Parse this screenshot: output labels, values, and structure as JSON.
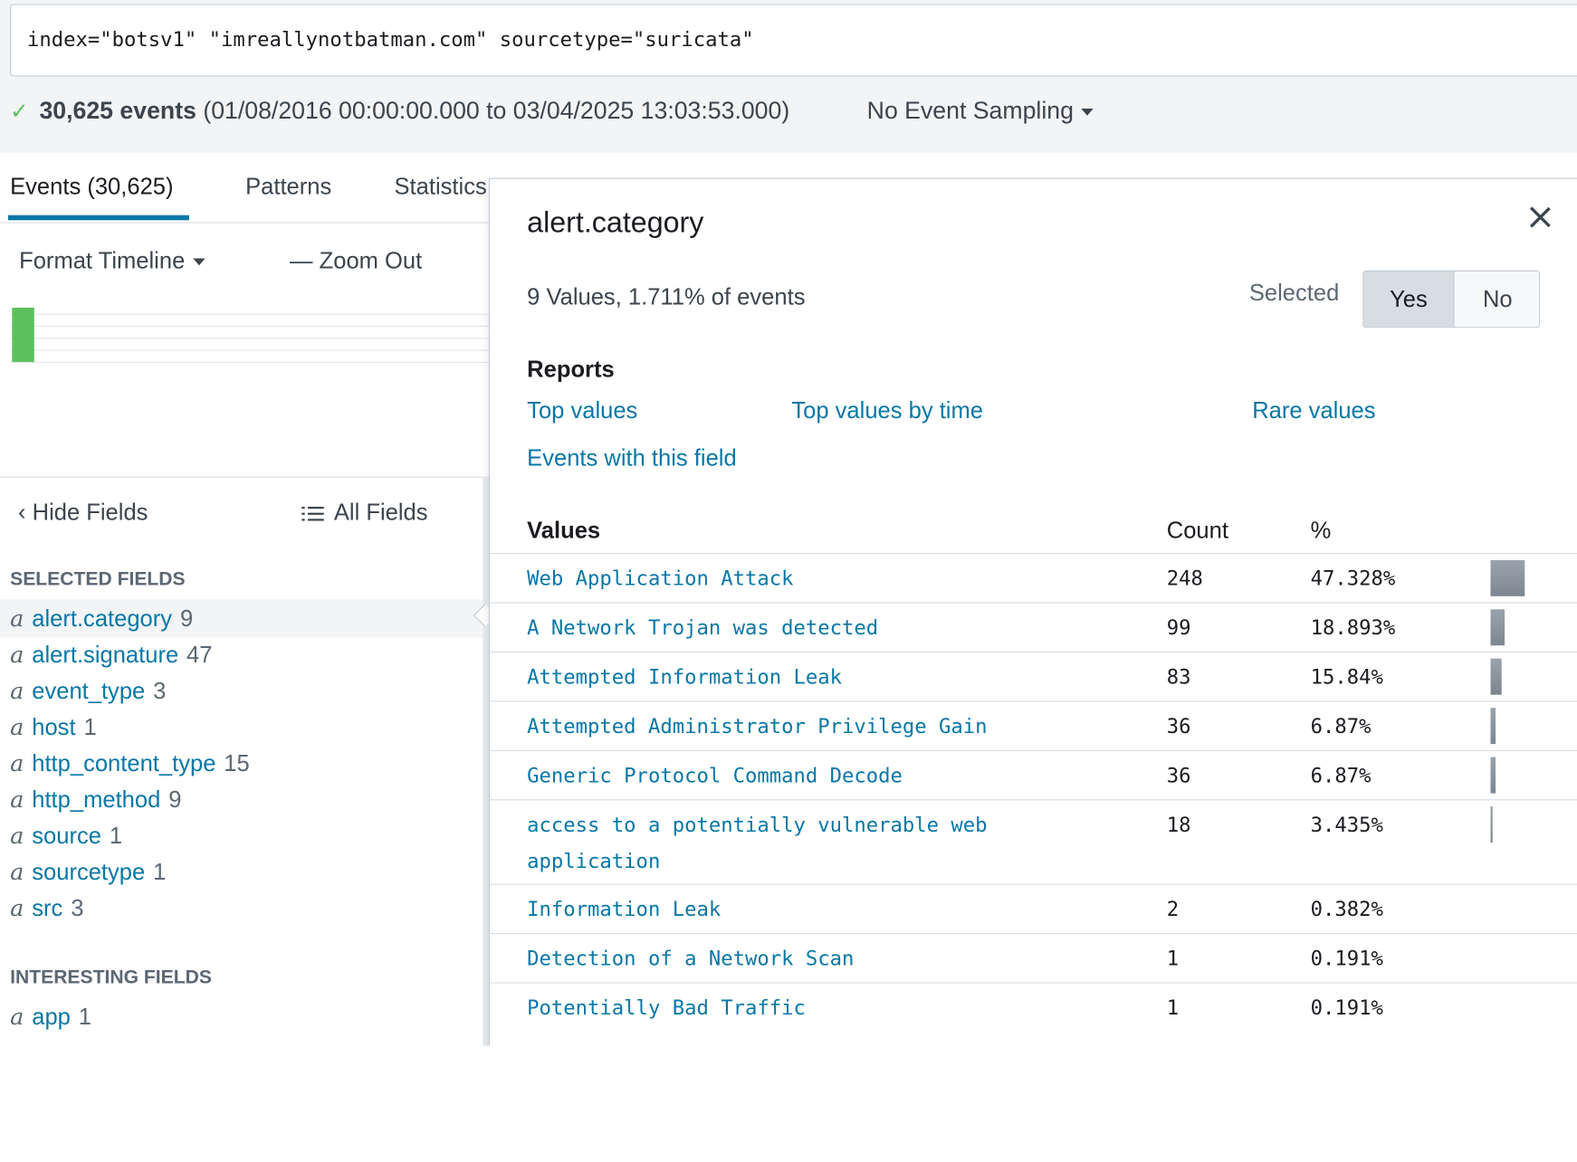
{
  "search": {
    "query": "index=\"botsv1\" \"imreallynotbatman.com\" sourcetype=\"suricata\""
  },
  "status": {
    "check": "✓",
    "event_count": "30,625 events",
    "time_range": "(01/08/2016 00:00:00.000 to 03/04/2025 13:03:53.000)",
    "sampling": "No Event Sampling"
  },
  "tabs": [
    {
      "label": "Events (30,625)",
      "active": true
    },
    {
      "label": "Patterns"
    },
    {
      "label": "Statistics"
    }
  ],
  "timeline": {
    "format_label": "Format Timeline",
    "zoom_out_label": "Zoom Out",
    "zoom_out_symbol": "—"
  },
  "fields": {
    "hide_label": "Hide Fields",
    "hide_symbol": "‹",
    "all_label": "All Fields",
    "selected_title": "SELECTED FIELDS",
    "interesting_title": "INTERESTING FIELDS",
    "selected": [
      {
        "type": "a",
        "name": "alert.category",
        "count": "9"
      },
      {
        "type": "a",
        "name": "alert.signature",
        "count": "47"
      },
      {
        "type": "a",
        "name": "event_type",
        "count": "3"
      },
      {
        "type": "a",
        "name": "host",
        "count": "1"
      },
      {
        "type": "a",
        "name": "http_content_type",
        "count": "15"
      },
      {
        "type": "a",
        "name": "http_method",
        "count": "9"
      },
      {
        "type": "a",
        "name": "source",
        "count": "1"
      },
      {
        "type": "a",
        "name": "sourcetype",
        "count": "1"
      },
      {
        "type": "a",
        "name": "src",
        "count": "3"
      }
    ],
    "interesting": [
      {
        "type": "a",
        "name": "app",
        "count": "1"
      }
    ]
  },
  "popup": {
    "title": "alert.category",
    "summary": "9 Values, 1.711% of events",
    "selected_label": "Selected",
    "toggle_yes": "Yes",
    "toggle_no": "No",
    "toggle_value": "Yes",
    "reports_title": "Reports",
    "reports": {
      "top_values": "Top values",
      "top_values_by_time": "Top values by time",
      "rare_values": "Rare values",
      "events_with_field": "Events with this field"
    },
    "headers": {
      "values": "Values",
      "count": "Count",
      "pct": "%"
    },
    "values": [
      {
        "name": "Web Application Attack",
        "count": "248",
        "pct": "47.328%",
        "fraction": 0.47328
      },
      {
        "name": "A Network Trojan was detected",
        "count": "99",
        "pct": "18.893%",
        "fraction": 0.18893
      },
      {
        "name": "Attempted Information Leak",
        "count": "83",
        "pct": "15.84%",
        "fraction": 0.1584
      },
      {
        "name": "Attempted Administrator Privilege Gain",
        "count": "36",
        "pct": "6.87%",
        "fraction": 0.0687
      },
      {
        "name": "Generic Protocol Command Decode",
        "count": "36",
        "pct": "6.87%",
        "fraction": 0.0687
      },
      {
        "name": "access to a potentially vulnerable web application",
        "count": "18",
        "pct": "3.435%",
        "fraction": 0.03435
      },
      {
        "name": "Information Leak",
        "count": "2",
        "pct": "0.382%",
        "fraction": 0.00382
      },
      {
        "name": "Detection of a Network Scan",
        "count": "1",
        "pct": "0.191%",
        "fraction": 0.00191
      },
      {
        "name": "Potentially Bad Traffic",
        "count": "1",
        "pct": "0.191%",
        "fraction": 0.00191
      }
    ]
  },
  "colors": {
    "link": "#0877a6",
    "accent": "#0877a6",
    "success": "#5cc05c",
    "timeline_bar": "#5cc05c"
  }
}
